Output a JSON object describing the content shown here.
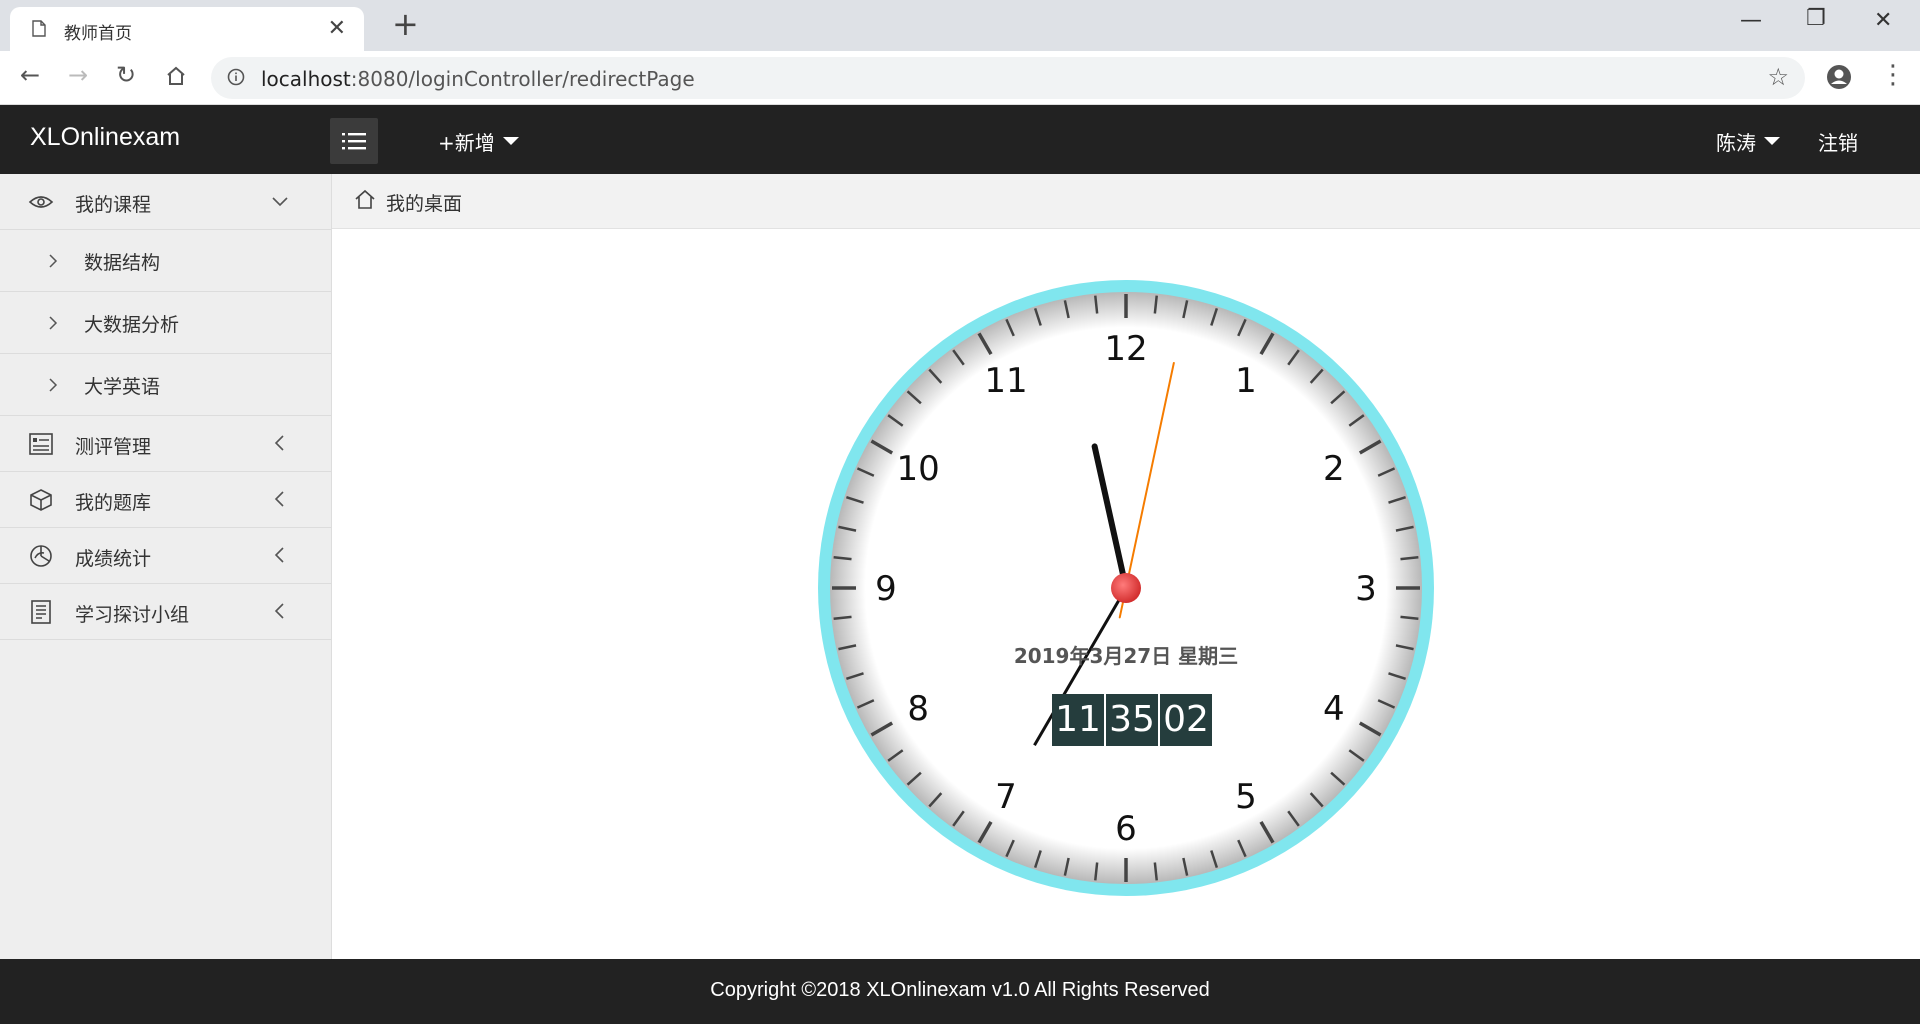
{
  "browser": {
    "tab_title": "教师首页",
    "url_host": "localhost",
    "url_rest": ":8080/loginController/redirectPage"
  },
  "header": {
    "logo": "XLOnlinexam",
    "add_label": "+新增",
    "user_name": "陈涛",
    "logout_label": "注销"
  },
  "sidebar": {
    "groups": [
      {
        "label": "我的课程",
        "icon": "eye-icon",
        "expanded": true,
        "items": [
          {
            "label": "数据结构"
          },
          {
            "label": "大数据分析"
          },
          {
            "label": "大学英语"
          }
        ]
      },
      {
        "label": "测评管理",
        "icon": "form-icon",
        "expanded": false
      },
      {
        "label": "我的题库",
        "icon": "box-icon",
        "expanded": false
      },
      {
        "label": "成绩统计",
        "icon": "chart-icon",
        "expanded": false
      },
      {
        "label": "学习探讨小组",
        "icon": "notebook-icon",
        "expanded": false
      }
    ]
  },
  "breadcrumb": {
    "label": "我的桌面"
  },
  "clock": {
    "numbers": [
      "12",
      "1",
      "2",
      "3",
      "4",
      "5",
      "6",
      "7",
      "8",
      "9",
      "10",
      "11"
    ],
    "date_text": "2019年3月27日 星期三",
    "hours": "11",
    "minutes": "35",
    "seconds": "02",
    "ring_color": "#80e6ee",
    "center_color": "#e53935",
    "second_hand_color": "#f57c00"
  },
  "footer": {
    "copyright": "Copyright ©2018 XLOnlinexam v1.0 All Rights Reserved"
  }
}
